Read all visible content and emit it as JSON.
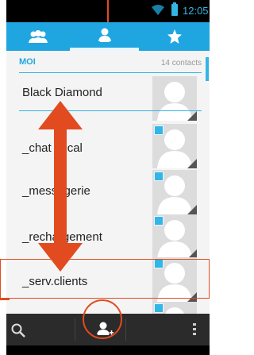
{
  "status_bar": {
    "time": "12:05"
  },
  "tabs": [
    {
      "icon": "groups-icon",
      "selected": false
    },
    {
      "icon": "person-icon",
      "selected": true
    },
    {
      "icon": "star-icon",
      "selected": false
    }
  ],
  "section": {
    "label": "MOI",
    "count": "14 contacts"
  },
  "contacts": [
    {
      "name": "Black Diamond",
      "favorite": false
    },
    {
      "name": "_chat vocal",
      "favorite": true
    },
    {
      "name": "_messagerie",
      "favorite": true
    },
    {
      "name": "_rechargement",
      "favorite": true
    },
    {
      "name": "_serv.clients",
      "favorite": true
    }
  ],
  "bottom_bar": {
    "search_icon": "search-icon",
    "add_contact_icon": "add-contact-icon",
    "menu_icon": "overflow-menu-icon"
  },
  "colors": {
    "accent": "#1fa6e0",
    "holo_blue": "#33b5e5",
    "annotation": "#e24b1f"
  }
}
